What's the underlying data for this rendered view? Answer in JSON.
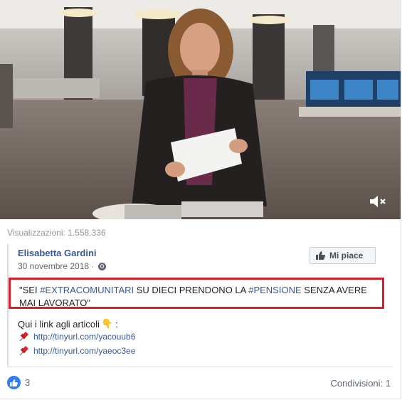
{
  "video": {
    "mute_icon": "speaker-muted-icon"
  },
  "stats": {
    "views_label": "Visualizzazioni: 1.558.336"
  },
  "post": {
    "author": "Elisabetta Gardini",
    "date": "30 novembre 2018 · ",
    "privacy_icon": "globe-icon",
    "like_page_label": "Mi piace",
    "quote": {
      "p1": "\"SEI ",
      "tag1": "#EXTRACOMUNITARI",
      "p2": " SU DIECI PRENDONO LA ",
      "tag2": "#PENSIONE",
      "p3": " SENZA AVERE MAI LAVORATO\""
    },
    "links_intro": "Qui i link agli articoli",
    "links_emoji": "👇",
    "links_suffix": ":",
    "links": [
      {
        "icon": "pushpin-icon",
        "text": "http://tinyurl.com/yacouub6"
      },
      {
        "icon": "pushpin-icon",
        "text": "http://tinyurl.com/yaeoc3ee"
      }
    ]
  },
  "footer": {
    "likes_count": "3",
    "shares_label": "Condivisioni: 1"
  },
  "colors": {
    "link": "#365899",
    "highlight_border": "#d6212b",
    "like_blue": "#2f80ed"
  }
}
